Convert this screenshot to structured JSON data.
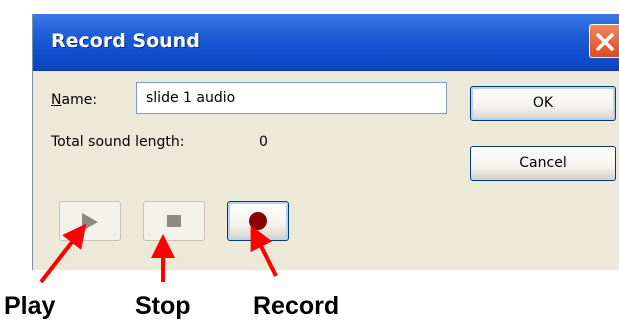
{
  "window": {
    "title": "Record Sound",
    "close_icon": "close-icon"
  },
  "form": {
    "name_label_access_key": "N",
    "name_label_rest": "ame:",
    "name_value": "slide 1 audio",
    "total_label": "Total sound length:",
    "total_value": "0"
  },
  "buttons": {
    "ok": "OK",
    "cancel": "Cancel"
  },
  "media_controls": [
    {
      "name": "play",
      "icon": "play-icon",
      "enabled": false
    },
    {
      "name": "stop",
      "icon": "stop-icon",
      "enabled": false
    },
    {
      "name": "record",
      "icon": "record-icon",
      "enabled": true
    }
  ],
  "annotations": {
    "play": "Play",
    "stop": "Stop",
    "record": "Record"
  },
  "colors": {
    "titlebar": "#0f4fd0",
    "dialog_bg": "#ECE9D8",
    "close_button": "#de4a20",
    "record_dot": "#8b0000",
    "arrow": "#ff0000"
  }
}
